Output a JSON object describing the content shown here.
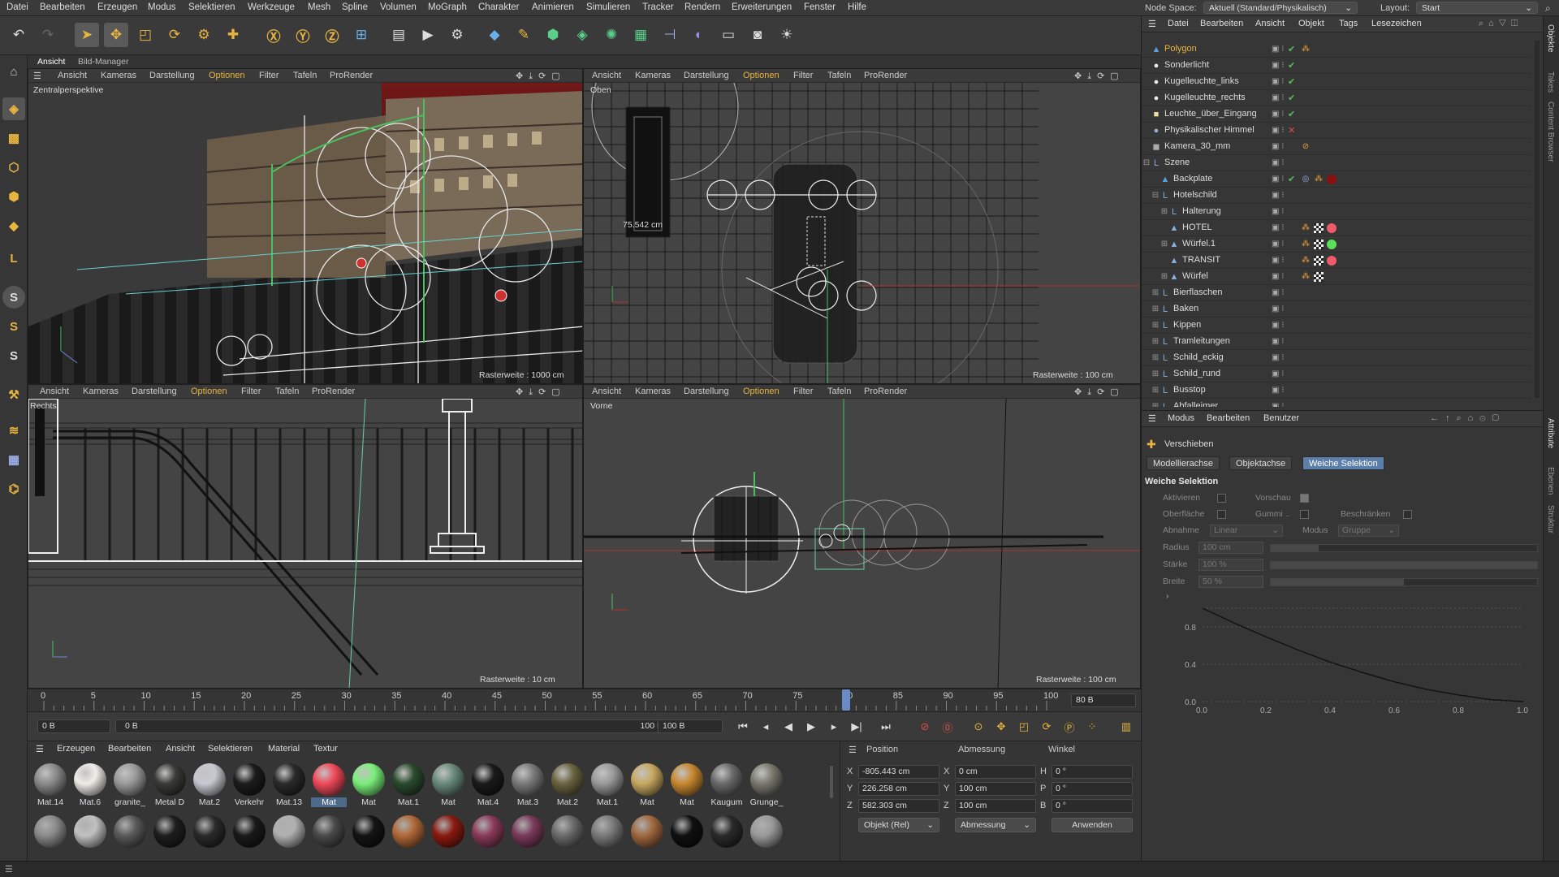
{
  "menubar": {
    "items": [
      "Datei",
      "Bearbeiten",
      "Erzeugen",
      "Modus",
      "Selektieren",
      "Werkzeuge",
      "Mesh",
      "Spline",
      "Volumen",
      "MoGraph",
      "Charakter",
      "Animieren",
      "Simulieren",
      "Tracker",
      "Rendern",
      "Erweiterungen",
      "Fenster",
      "Hilfe"
    ],
    "node_space_label": "Node Space:",
    "node_space_value": "Aktuell (Standard/Physikalisch)",
    "layout_label": "Layout:",
    "layout_value": "Start"
  },
  "view_tabs": [
    "Ansicht",
    "Bild-Manager"
  ],
  "viewport_menu": [
    "Ansicht",
    "Kameras",
    "Darstellung",
    "Optionen",
    "Filter",
    "Tafeln",
    "ProRender"
  ],
  "viewports": {
    "perspective": {
      "label": "Zentralperspektive",
      "grid": "Rasterweite : 1000 cm"
    },
    "top": {
      "label": "Oben",
      "grid": "Rasterweite : 100 cm",
      "measure": "75.542 cm"
    },
    "right": {
      "label": "Rechts",
      "grid": "Rasterweite : 10 cm"
    },
    "front": {
      "label": "Vorne",
      "grid": "Rasterweite : 100 cm"
    }
  },
  "timeline": {
    "ticks": [
      "0",
      "5",
      "10",
      "15",
      "20",
      "25",
      "30",
      "35",
      "40",
      "45",
      "50",
      "55",
      "60",
      "65",
      "70",
      "75",
      "80",
      "85",
      "90",
      "95",
      "100"
    ],
    "current_frame": 80,
    "current_frame_label": "80 B",
    "start_field": "0 B",
    "start_field2": "0 B",
    "end_field": "100 B",
    "end_field2": "100 B"
  },
  "material_manager": {
    "menu": [
      "Erzeugen",
      "Bearbeiten",
      "Ansicht",
      "Selektieren",
      "Material",
      "Textur"
    ],
    "row1": [
      {
        "name": "Mat.14",
        "color": "#8a8a8a"
      },
      {
        "name": "Mat.6",
        "color": "#f0ede8"
      },
      {
        "name": "granite_",
        "color": "#9a9a9a"
      },
      {
        "name": "Metal D",
        "color": "#3a3a36"
      },
      {
        "name": "Mat.2",
        "color": "#c8c8d0"
      },
      {
        "name": "Verkehr",
        "color": "#1c1c1c"
      },
      {
        "name": "Mat.13",
        "color": "#2a2a2a"
      },
      {
        "name": "Mat",
        "color": "#f04a5a"
      },
      {
        "name": "Mat",
        "color": "#7af07a"
      },
      {
        "name": "Mat.1",
        "color": "#2a4a2e"
      },
      {
        "name": "Mat",
        "color": "#6a8a7a"
      },
      {
        "name": "Mat.4",
        "color": "#1a1a1a"
      },
      {
        "name": "Mat.3",
        "color": "#7a7a7a"
      },
      {
        "name": "Mat.2",
        "color": "#6a6440"
      },
      {
        "name": "Mat.1",
        "color": "#9a9a9a"
      },
      {
        "name": "Mat",
        "color": "#c8a860"
      },
      {
        "name": "Mat",
        "color": "#c88830"
      },
      {
        "name": "Kaugum",
        "color": "#6a6a6a"
      },
      {
        "name": "Grunge_",
        "color": "#7a7a70"
      }
    ],
    "row2_colors": [
      "#8a8a8a",
      "#c0c0c0",
      "#5a5a5a",
      "#1e1e1e",
      "#2a2a2a",
      "#1a1a1a",
      "#b0b0b0",
      "#4a4a4a",
      "#141414",
      "#b06838",
      "#8a1a10",
      "#8a3a5a",
      "#7a3a5a",
      "#6a6a6a",
      "#7a7a7a",
      "#a06840",
      "#101010",
      "#2a2a2a",
      "#9a9a9a"
    ],
    "selected_index": 7
  },
  "coord_manager": {
    "headers": [
      "Position",
      "Abmessung",
      "Winkel"
    ],
    "rows": [
      {
        "axis": "X",
        "pos": "-805.443 cm",
        "dim_axis": "X",
        "dim": "0 cm",
        "rot_axis": "H",
        "rot": "0 °"
      },
      {
        "axis": "Y",
        "pos": "226.258 cm",
        "dim_axis": "Y",
        "dim": "100 cm",
        "rot_axis": "P",
        "rot": "0 °"
      },
      {
        "axis": "Z",
        "pos": "582.303 cm",
        "dim_axis": "Z",
        "dim": "100 cm",
        "rot_axis": "B",
        "rot": "0 °"
      }
    ],
    "mode_dropdown": "Objekt (Rel)",
    "size_dropdown": "Abmessung",
    "apply_button": "Anwenden"
  },
  "object_manager": {
    "menu": [
      "Datei",
      "Bearbeiten",
      "Ansicht",
      "Objekt",
      "Tags",
      "Lesezeichen"
    ],
    "objects": [
      {
        "name": "Polygon",
        "indent": 0,
        "icon": "▲",
        "icon_color": "#5aa0e0",
        "highlight": true,
        "check": "green",
        "tags": [
          "orange"
        ]
      },
      {
        "name": "Sonderlicht",
        "indent": 0,
        "icon": "●",
        "icon_color": "#e8e8e8",
        "check": "green"
      },
      {
        "name": "Kugelleuchte_links",
        "indent": 0,
        "icon": "●",
        "icon_color": "#e8e8e8",
        "check": "green"
      },
      {
        "name": "Kugelleuchte_rechts",
        "indent": 0,
        "icon": "●",
        "icon_color": "#e8e8e8",
        "check": "green"
      },
      {
        "name": "Leuchte_über_Eingang",
        "indent": 0,
        "icon": "■",
        "icon_color": "#e8e0a0",
        "check": "green"
      },
      {
        "name": "Physikalischer Himmel",
        "indent": 0,
        "icon": "●",
        "icon_color": "#9ab0c8",
        "check": "red"
      },
      {
        "name": "Kamera_30_mm",
        "indent": 0,
        "icon": "◼",
        "icon_color": "#aaaaaa",
        "tags": [
          "forbid"
        ]
      },
      {
        "name": "Szene",
        "indent": 0,
        "icon": "L",
        "icon_color": "#8ab0e0",
        "expander": "−"
      },
      {
        "name": "Backplate",
        "indent": 1,
        "icon": "▲",
        "icon_color": "#5aa0e0",
        "check": "green",
        "tags": [
          "target",
          "orange",
          "darkred"
        ]
      },
      {
        "name": "Hotelschild",
        "indent": 1,
        "icon": "L",
        "icon_color": "#8ab0e0",
        "expander": "−"
      },
      {
        "name": "Halterung",
        "indent": 2,
        "icon": "L",
        "icon_color": "#8ab0e0",
        "expander": "+"
      },
      {
        "name": "HOTEL",
        "indent": 2,
        "icon": "▲",
        "icon_color": "#8ab0e0",
        "tags": [
          "orange",
          "checker",
          "pink"
        ]
      },
      {
        "name": "Würfel.1",
        "indent": 2,
        "icon": "▲",
        "icon_color": "#8ab0e0",
        "expander": "+",
        "tags": [
          "orange",
          "checker",
          "green"
        ]
      },
      {
        "name": "TRANSIT",
        "indent": 2,
        "icon": "▲",
        "icon_color": "#8ab0e0",
        "tags": [
          "orange",
          "checker",
          "pink"
        ]
      },
      {
        "name": "Würfel",
        "indent": 2,
        "icon": "▲",
        "icon_color": "#8ab0e0",
        "expander": "+",
        "tags": [
          "orange",
          "checker"
        ]
      },
      {
        "name": "Bierflaschen",
        "indent": 1,
        "icon": "L",
        "icon_color": "#8ab0e0",
        "expander": "+"
      },
      {
        "name": "Baken",
        "indent": 1,
        "icon": "L",
        "icon_color": "#8ab0e0",
        "expander": "+"
      },
      {
        "name": "Kippen",
        "indent": 1,
        "icon": "L",
        "icon_color": "#8ab0e0",
        "expander": "+"
      },
      {
        "name": "Tramleitungen",
        "indent": 1,
        "icon": "L",
        "icon_color": "#8ab0e0",
        "expander": "+"
      },
      {
        "name": "Schild_eckig",
        "indent": 1,
        "icon": "L",
        "icon_color": "#8ab0e0",
        "expander": "+"
      },
      {
        "name": "Schild_rund",
        "indent": 1,
        "icon": "L",
        "icon_color": "#8ab0e0",
        "expander": "+"
      },
      {
        "name": "Busstop",
        "indent": 1,
        "icon": "L",
        "icon_color": "#8ab0e0",
        "expander": "+"
      },
      {
        "name": "Abfalleimer",
        "indent": 1,
        "icon": "L",
        "icon_color": "#8ab0e0",
        "expander": "+"
      }
    ]
  },
  "attribute_manager": {
    "menu": [
      "Modus",
      "Bearbeiten",
      "Benutzer"
    ],
    "tool_name": "Verschieben",
    "tabs": [
      "Modellierachse",
      "Objektachse",
      "Weiche Selektion"
    ],
    "active_tab": 2,
    "section_title": "Weiche Selektion",
    "fields": {
      "aktivieren": "Aktivieren",
      "vorschau": "Vorschau",
      "oberflaeche": "Oberfläche",
      "gummi": "Gummi ..",
      "beschraenken": "Beschränken",
      "abnahme": "Abnahme",
      "abnahme_value": "Linear",
      "modus": "Modus",
      "modus_value": "Gruppe",
      "radius": "Radius",
      "radius_value": "100 cm",
      "staerke": "Stärke",
      "staerke_value": "100 %",
      "breite": "Breite",
      "breite_value": "50 %"
    },
    "radius_fraction": 0.18,
    "staerke_fraction": 1.0,
    "breite_fraction": 0.5,
    "curve": {
      "x_ticks": [
        "0.0",
        "0.2",
        "0.4",
        "0.6",
        "0.8",
        "1.0"
      ],
      "y_ticks": [
        "0.8",
        "0.4",
        "0.0"
      ],
      "points": [
        [
          0,
          1
        ],
        [
          0.1,
          0.84
        ],
        [
          0.2,
          0.69
        ],
        [
          0.3,
          0.55
        ],
        [
          0.4,
          0.42
        ],
        [
          0.5,
          0.31
        ],
        [
          0.6,
          0.21
        ],
        [
          0.7,
          0.13
        ],
        [
          0.8,
          0.07
        ],
        [
          0.9,
          0.02
        ],
        [
          1,
          0
        ]
      ]
    }
  },
  "right_tabs": [
    "Objekte",
    "Takes",
    "Content Browser",
    "Attribute",
    "Ebenen",
    "Struktur"
  ]
}
